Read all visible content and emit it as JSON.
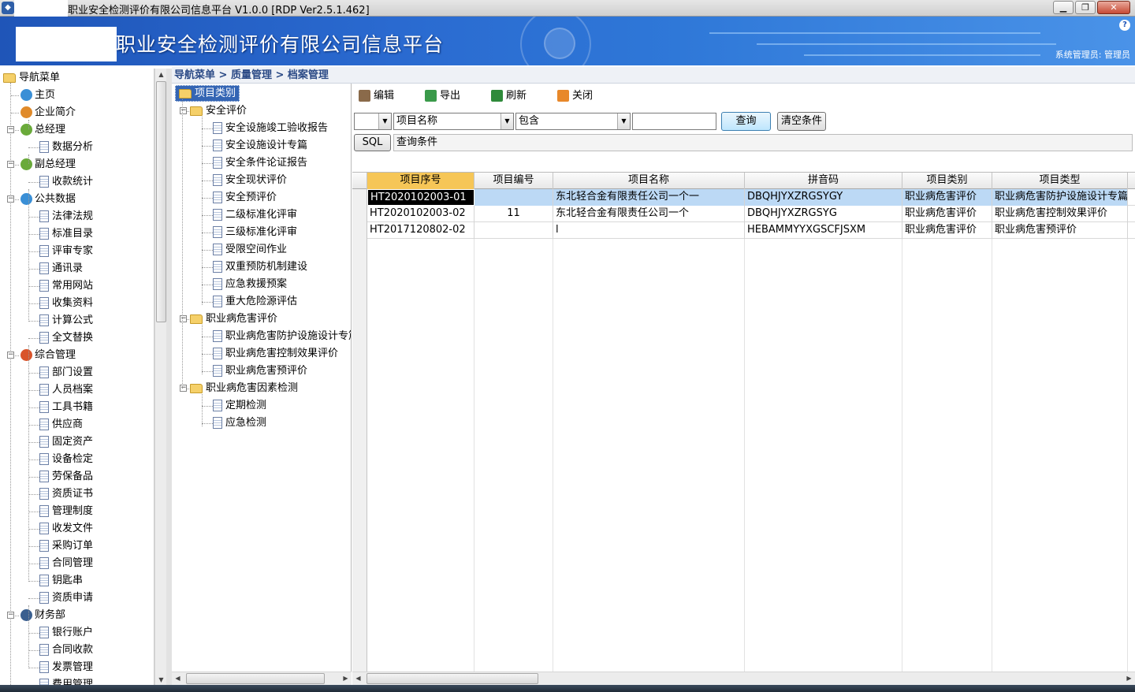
{
  "window": {
    "title": "职业安全检测评价有限公司信息平台 V1.0.0 [RDP Ver2.5.1.462]",
    "buttons": {
      "minimize": "▁",
      "maximize": "❐",
      "close": "✕"
    }
  },
  "banner": {
    "title": "职业安全检测评价有限公司信息平台",
    "user": "系统管理员: 管理员",
    "help": "?"
  },
  "nav": {
    "root": "导航菜单",
    "items": [
      {
        "label": "主页",
        "level": 1,
        "icon": "home-icon",
        "color": "#3a8fd6"
      },
      {
        "label": "企业简介",
        "level": 1,
        "icon": "user-icon",
        "color": "#e08a2a"
      },
      {
        "label": "总经理",
        "level": 1,
        "icon": "group-icon",
        "color": "#6aaa3a",
        "expander": "-"
      },
      {
        "label": "数据分析",
        "level": 2
      },
      {
        "label": "副总经理",
        "level": 1,
        "icon": "group-icon",
        "color": "#6aaa3a",
        "expander": "-"
      },
      {
        "label": "收款统计",
        "level": 2
      },
      {
        "label": "公共数据",
        "level": 1,
        "icon": "globe-icon",
        "color": "#3a8fd6",
        "expander": "-"
      },
      {
        "label": "法律法规",
        "level": 2
      },
      {
        "label": "标准目录",
        "level": 2
      },
      {
        "label": "评审专家",
        "level": 2
      },
      {
        "label": "通讯录",
        "level": 2
      },
      {
        "label": "常用网站",
        "level": 2
      },
      {
        "label": "收集资料",
        "level": 2
      },
      {
        "label": "计算公式",
        "level": 2
      },
      {
        "label": "全文替换",
        "level": 2
      },
      {
        "label": "综合管理",
        "level": 1,
        "icon": "windows-icon",
        "color": "#d9542b",
        "expander": "-"
      },
      {
        "label": "部门设置",
        "level": 2
      },
      {
        "label": "人员档案",
        "level": 2
      },
      {
        "label": "工具书籍",
        "level": 2
      },
      {
        "label": "供应商",
        "level": 2
      },
      {
        "label": "固定资产",
        "level": 2
      },
      {
        "label": "设备检定",
        "level": 2
      },
      {
        "label": "劳保备品",
        "level": 2
      },
      {
        "label": "资质证书",
        "level": 2
      },
      {
        "label": "管理制度",
        "level": 2
      },
      {
        "label": "收发文件",
        "level": 2
      },
      {
        "label": "采购订单",
        "level": 2
      },
      {
        "label": "合同管理",
        "level": 2
      },
      {
        "label": "钥匙串",
        "level": 2
      },
      {
        "label": "资质申请",
        "level": 2
      },
      {
        "label": "财务部",
        "level": 1,
        "icon": "monitor-icon",
        "color": "#3a5f8f",
        "expander": "-"
      },
      {
        "label": "银行账户",
        "level": 2
      },
      {
        "label": "合同收款",
        "level": 2
      },
      {
        "label": "发票管理",
        "level": 2
      },
      {
        "label": "费用管理",
        "level": 2
      }
    ]
  },
  "breadcrumb": "导航菜单 > 质量管理 > 档案管理",
  "categories": {
    "root": "项目类别",
    "groups": [
      {
        "label": "安全评价",
        "children": [
          "安全设施竣工验收报告",
          "安全设施设计专篇",
          "安全条件论证报告",
          "安全现状评价",
          "安全预评价",
          "二级标准化评审",
          "三级标准化评审",
          "受限空间作业",
          "双重预防机制建设",
          "应急救援预案",
          "重大危险源评估"
        ]
      },
      {
        "label": "职业病危害评价",
        "children": [
          "职业病危害防护设施设计专篇",
          "职业病危害控制效果评价",
          "职业病危害预评价"
        ]
      },
      {
        "label": "职业病危害因素检测",
        "children": [
          "定期检测",
          "应急检测"
        ]
      }
    ]
  },
  "toolbar": {
    "edit": "编辑",
    "export": "导出",
    "refresh": "刷新",
    "close": "关闭"
  },
  "filter": {
    "logic": "",
    "field": "项目名称",
    "operator": "包含",
    "value": "",
    "query": "查询",
    "clear": "清空条件",
    "sql": "SQL",
    "condition": "查询条件"
  },
  "grid": {
    "columns": [
      "项目序号",
      "项目编号",
      "项目名称",
      "拼音码",
      "项目类别",
      "项目类型"
    ],
    "rows": [
      [
        "HT2020102003-01",
        "",
        "东北轻合金有限责任公司一个一",
        "DBQHJYXZRGSYGY",
        "职业病危害评价",
        "职业病危害防护设施设计专篇"
      ],
      [
        "HT2020102003-02",
        "11",
        "东北轻合金有限责任公司一个",
        "DBQHJYXZRGSYG",
        "职业病危害评价",
        "职业病危害控制效果评价"
      ],
      [
        "HT2017120802-02",
        "",
        "l",
        "HEBAMMYYXGSCFJSXM",
        "职业病危害评价",
        "职业病危害预评价"
      ]
    ]
  }
}
